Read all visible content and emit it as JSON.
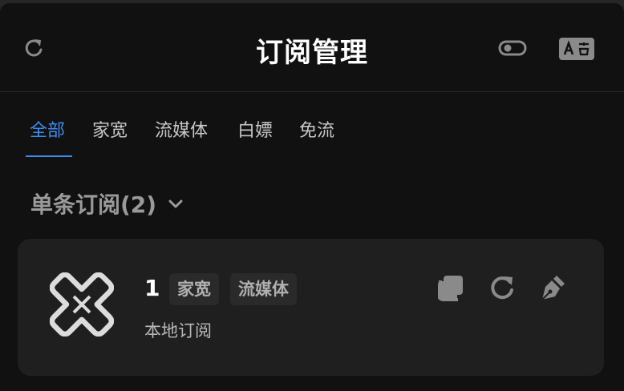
{
  "header": {
    "title": "订阅管理",
    "refresh_icon": "refresh-icon",
    "toggle_icon": "toggle-icon",
    "translate_icon": "translate-icon"
  },
  "tabs": [
    {
      "label": "全部",
      "active": true
    },
    {
      "label": "家宽",
      "active": false
    },
    {
      "label": "流媒体",
      "active": false
    },
    {
      "label": "白嫖",
      "active": false
    },
    {
      "label": "免流",
      "active": false
    }
  ],
  "group": {
    "title": "单条订阅(2)",
    "chevron_icon": "chevron-down-icon"
  },
  "subscription": {
    "name": "1",
    "tags": [
      "家宽",
      "流媒体"
    ],
    "type": "本地订阅",
    "icons": [
      "copy-icon",
      "refresh-icon",
      "edit-pen-icon"
    ]
  },
  "colors": {
    "background": "#111111",
    "card": "#1f1f1f",
    "accent": "#3f8cf0",
    "title": "#ffffff"
  }
}
